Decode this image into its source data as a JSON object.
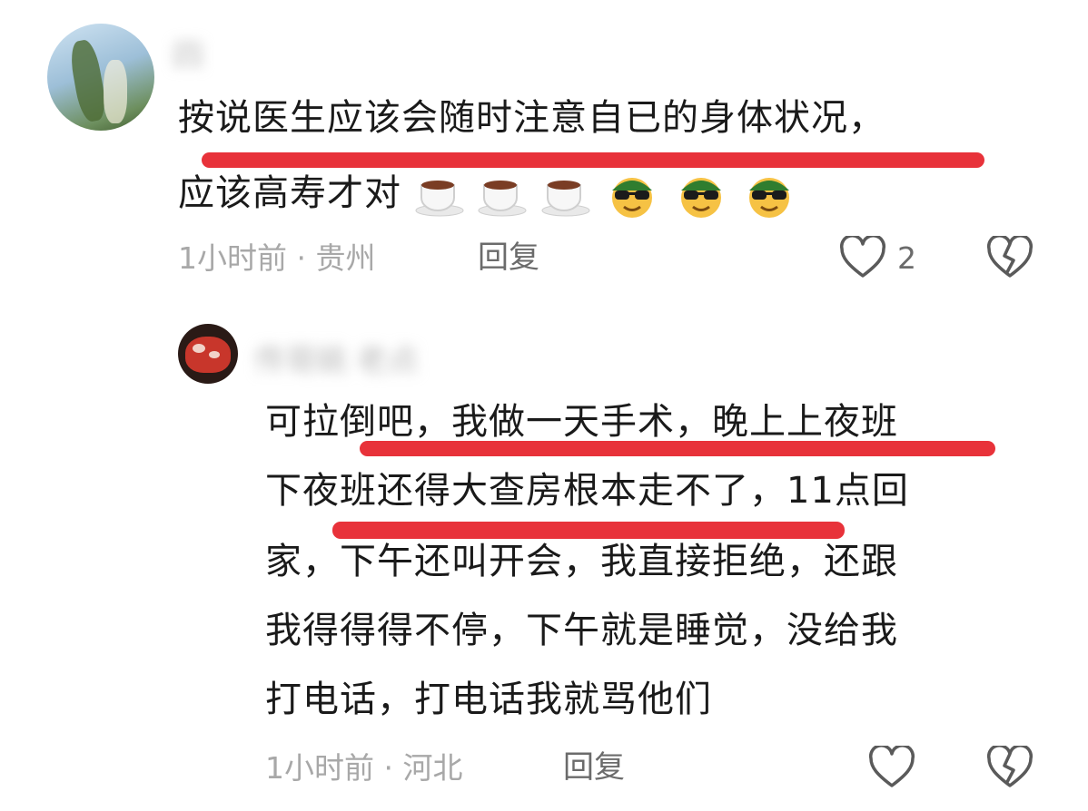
{
  "comment1": {
    "username": "四",
    "lines": [
      "按说医生应该会随时注意自已的身体状况，",
      "应该高寿才对"
    ],
    "emojis": [
      "coffee-icon",
      "coffee-icon",
      "coffee-icon",
      "cool-face-icon",
      "cool-face-icon",
      "cool-face-icon"
    ],
    "time_location": "1小时前 · 贵州",
    "reply_label": "回复",
    "like_count": "2"
  },
  "comment2": {
    "username": "传哥姚 老点",
    "lines": [
      "可拉倒吧，我做一天手术，晚上上夜班",
      "下夜班还得大查房根本走不了，11点回",
      "家，下午还叫开会，我直接拒绝，还跟",
      "我得得得不停，下午就是睡觉，没给我",
      "打电话，打电话我就骂他们"
    ],
    "time_location": "1小时前 · 河北",
    "reply_label": "回复"
  },
  "colors": {
    "highlight": "#e8323a",
    "meta": "#a8a8a8",
    "icon": "#5a5a5a"
  }
}
